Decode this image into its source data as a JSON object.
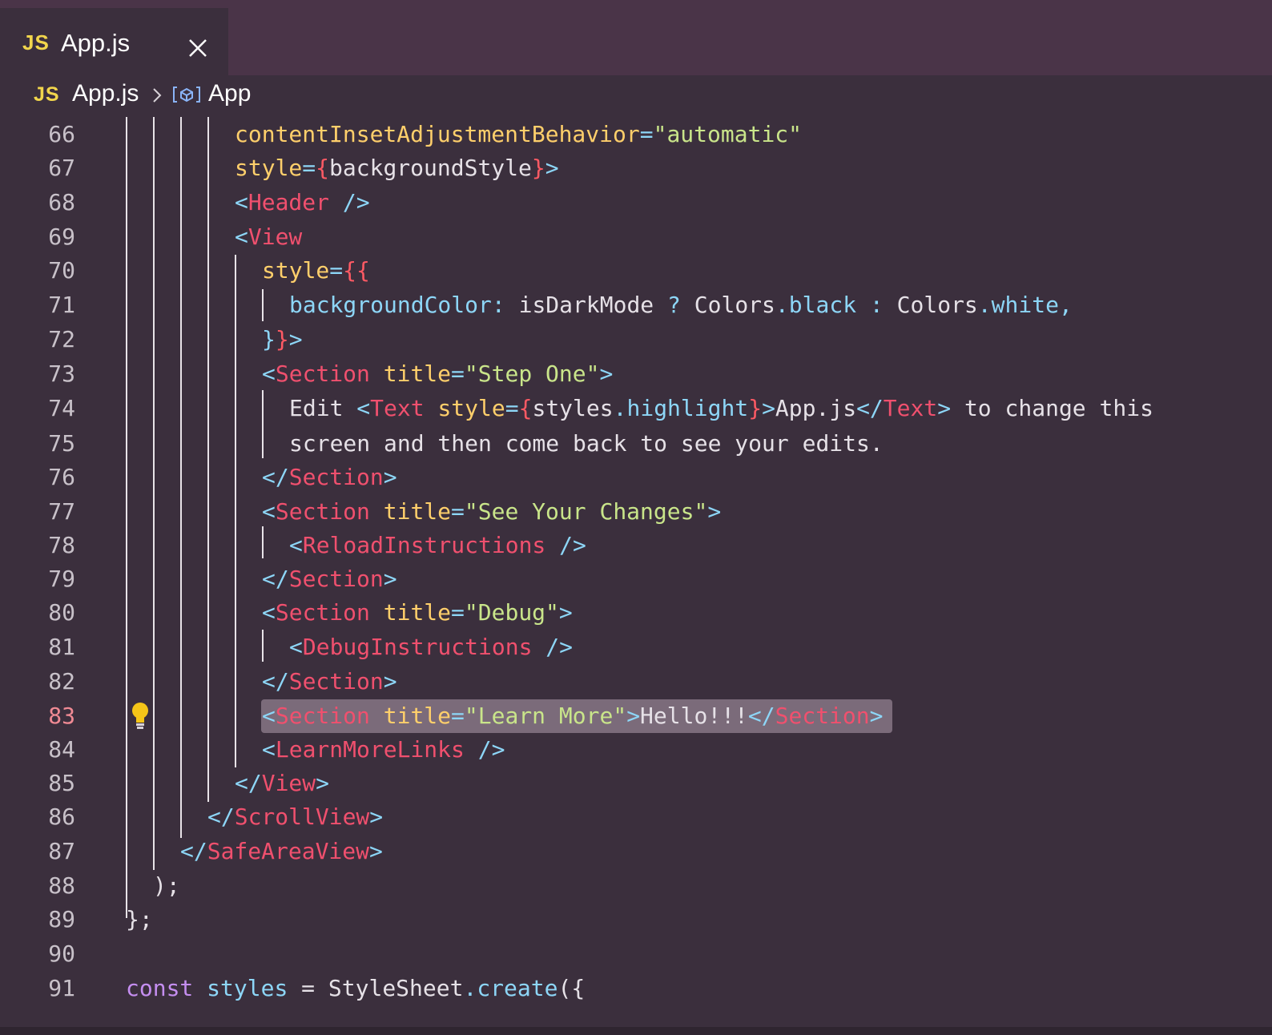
{
  "tab": {
    "badge": "JS",
    "label": "App.js"
  },
  "breadcrumb": {
    "badge": "JS",
    "file": "App.js",
    "symbol": "App"
  },
  "editor": {
    "active_line": "83",
    "lines": [
      {
        "n": "66",
        "seg": [
          [
            "contentInsetAdjustmentBehavior",
            "attr"
          ],
          [
            "=",
            "punc"
          ],
          [
            "\"automatic\"",
            "str"
          ]
        ]
      },
      {
        "n": "67",
        "seg": [
          [
            "style",
            "attr"
          ],
          [
            "=",
            "punc"
          ],
          [
            "{",
            "brace"
          ],
          [
            "backgroundStyle",
            "text"
          ],
          [
            "}",
            "brace"
          ],
          [
            ">",
            "punc"
          ]
        ]
      },
      {
        "n": "68",
        "seg": [
          [
            "<",
            "punc"
          ],
          [
            "Header",
            "tag"
          ],
          [
            " ",
            "text"
          ],
          [
            "/>",
            "punc"
          ]
        ]
      },
      {
        "n": "69",
        "seg": [
          [
            "<",
            "punc"
          ],
          [
            "View",
            "tag"
          ]
        ]
      },
      {
        "n": "70",
        "seg": [
          [
            "style",
            "attr"
          ],
          [
            "=",
            "punc"
          ],
          [
            "{{",
            "brace"
          ]
        ]
      },
      {
        "n": "71",
        "seg": [
          [
            "backgroundColor",
            "prop"
          ],
          [
            ": ",
            "punc"
          ],
          [
            "isDarkMode",
            "text"
          ],
          [
            " ? ",
            "punc"
          ],
          [
            "Colors",
            "text"
          ],
          [
            ".",
            "punc"
          ],
          [
            "black",
            "prop"
          ],
          [
            " : ",
            "punc"
          ],
          [
            "Colors",
            "text"
          ],
          [
            ".",
            "punc"
          ],
          [
            "white",
            "prop"
          ],
          [
            ",",
            "punc"
          ]
        ]
      },
      {
        "n": "72",
        "seg": [
          [
            "}",
            "punc"
          ],
          [
            "}",
            "brace"
          ],
          [
            ">",
            "punc"
          ]
        ]
      },
      {
        "n": "73",
        "seg": [
          [
            "<",
            "punc"
          ],
          [
            "Section",
            "tag"
          ],
          [
            " ",
            "text"
          ],
          [
            "title",
            "attr"
          ],
          [
            "=",
            "punc"
          ],
          [
            "\"Step One\"",
            "str"
          ],
          [
            ">",
            "punc"
          ]
        ]
      },
      {
        "n": "74",
        "seg": [
          [
            "Edit ",
            "text"
          ],
          [
            "<",
            "punc"
          ],
          [
            "Text",
            "tag"
          ],
          [
            " ",
            "text"
          ],
          [
            "style",
            "attr"
          ],
          [
            "=",
            "punc"
          ],
          [
            "{",
            "brace"
          ],
          [
            "styles",
            "text"
          ],
          [
            ".",
            "punc"
          ],
          [
            "highlight",
            "prop"
          ],
          [
            "}",
            "brace"
          ],
          [
            ">",
            "punc"
          ],
          [
            "App.js",
            "text"
          ],
          [
            "</",
            "punc"
          ],
          [
            "Text",
            "tag"
          ],
          [
            ">",
            "punc"
          ],
          [
            " to change this",
            "text"
          ]
        ]
      },
      {
        "n": "75",
        "seg": [
          [
            "screen and then come back to see your edits.",
            "text"
          ]
        ]
      },
      {
        "n": "76",
        "seg": [
          [
            "</",
            "punc"
          ],
          [
            "Section",
            "tag"
          ],
          [
            ">",
            "punc"
          ]
        ]
      },
      {
        "n": "77",
        "seg": [
          [
            "<",
            "punc"
          ],
          [
            "Section",
            "tag"
          ],
          [
            " ",
            "text"
          ],
          [
            "title",
            "attr"
          ],
          [
            "=",
            "punc"
          ],
          [
            "\"See Your Changes\"",
            "str"
          ],
          [
            ">",
            "punc"
          ]
        ]
      },
      {
        "n": "78",
        "seg": [
          [
            "<",
            "punc"
          ],
          [
            "ReloadInstructions",
            "tag"
          ],
          [
            " ",
            "text"
          ],
          [
            "/>",
            "punc"
          ]
        ]
      },
      {
        "n": "79",
        "seg": [
          [
            "</",
            "punc"
          ],
          [
            "Section",
            "tag"
          ],
          [
            ">",
            "punc"
          ]
        ]
      },
      {
        "n": "80",
        "seg": [
          [
            "<",
            "punc"
          ],
          [
            "Section",
            "tag"
          ],
          [
            " ",
            "text"
          ],
          [
            "title",
            "attr"
          ],
          [
            "=",
            "punc"
          ],
          [
            "\"Debug\"",
            "str"
          ],
          [
            ">",
            "punc"
          ]
        ]
      },
      {
        "n": "81",
        "seg": [
          [
            "<",
            "punc"
          ],
          [
            "DebugInstructions",
            "tag"
          ],
          [
            " ",
            "text"
          ],
          [
            "/>",
            "punc"
          ]
        ]
      },
      {
        "n": "82",
        "seg": [
          [
            "</",
            "punc"
          ],
          [
            "Section",
            "tag"
          ],
          [
            ">",
            "punc"
          ]
        ]
      },
      {
        "n": "83",
        "seg": [
          [
            "<",
            "punc"
          ],
          [
            "Section",
            "tag"
          ],
          [
            " ",
            "text"
          ],
          [
            "title",
            "attr"
          ],
          [
            "=",
            "punc"
          ],
          [
            "\"Learn More\"",
            "str"
          ],
          [
            ">",
            "punc"
          ],
          [
            "Hello!!!",
            "text"
          ],
          [
            "</",
            "punc"
          ],
          [
            "Section",
            "tag"
          ],
          [
            ">",
            "punc"
          ]
        ]
      },
      {
        "n": "84",
        "seg": [
          [
            "<",
            "punc"
          ],
          [
            "LearnMoreLinks",
            "tag"
          ],
          [
            " ",
            "text"
          ],
          [
            "/>",
            "punc"
          ]
        ]
      },
      {
        "n": "85",
        "seg": [
          [
            "</",
            "punc"
          ],
          [
            "View",
            "tag"
          ],
          [
            ">",
            "punc"
          ]
        ]
      },
      {
        "n": "86",
        "seg": [
          [
            "</",
            "punc"
          ],
          [
            "ScrollView",
            "tag"
          ],
          [
            ">",
            "punc"
          ]
        ]
      },
      {
        "n": "87",
        "seg": [
          [
            "</",
            "punc"
          ],
          [
            "SafeAreaView",
            "tag"
          ],
          [
            ">",
            "punc"
          ]
        ]
      },
      {
        "n": "88",
        "seg": [
          [
            ");",
            "text"
          ]
        ]
      },
      {
        "n": "89",
        "seg": [
          [
            "};",
            "text"
          ]
        ]
      },
      {
        "n": "90",
        "seg": []
      },
      {
        "n": "91",
        "seg": [
          [
            "const",
            "kw"
          ],
          [
            " ",
            "text"
          ],
          [
            "styles",
            "prop"
          ],
          [
            " = ",
            "text"
          ],
          [
            "StyleSheet",
            "text"
          ],
          [
            ".",
            "punc"
          ],
          [
            "create",
            "fn"
          ],
          [
            "({",
            "text"
          ]
        ]
      }
    ]
  },
  "colors": {
    "background": "#3b2f3d",
    "tab_bar": "#4a3448",
    "tag": "#f0506e",
    "attribute": "#ffcf6b",
    "string": "#c9e58a",
    "punctuation": "#8dd6f7",
    "keyword": "#c58ef0",
    "selection": "#7b6b7a"
  }
}
